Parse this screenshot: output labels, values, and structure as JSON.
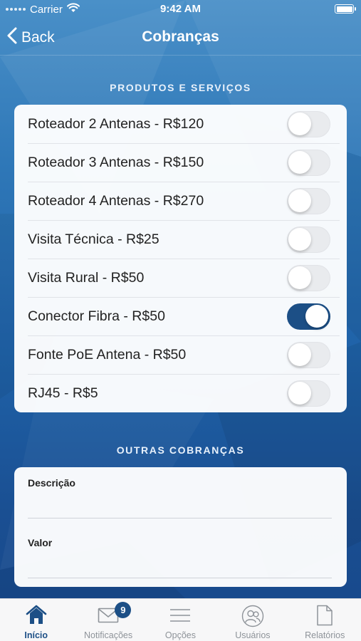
{
  "status_bar": {
    "carrier": "Carrier",
    "time": "9:42 AM"
  },
  "nav": {
    "back_label": "Back",
    "title": "Cobranças"
  },
  "products": {
    "section_title": "PRODUTOS E SERVIÇOS",
    "items": [
      {
        "label": "Roteador 2 Antenas - R$120",
        "on": false
      },
      {
        "label": "Roteador 3 Antenas - R$150",
        "on": false
      },
      {
        "label": "Roteador 4 Antenas - R$270",
        "on": false
      },
      {
        "label": "Visita Técnica - R$25",
        "on": false
      },
      {
        "label": "Visita Rural - R$50",
        "on": false
      },
      {
        "label": "Conector Fibra - R$50",
        "on": true
      },
      {
        "label": "Fonte PoE Antena - R$50",
        "on": false
      },
      {
        "label": "RJ45 - R$5",
        "on": false
      }
    ]
  },
  "other": {
    "section_title": "OUTRAS COBRANÇAS",
    "description_label": "Descrição",
    "description_value": "",
    "value_label": "Valor",
    "value_value": ""
  },
  "tabs": [
    {
      "label": "Início",
      "icon": "home-icon",
      "active": true
    },
    {
      "label": "Notificações",
      "icon": "envelope-icon",
      "badge": "9"
    },
    {
      "label": "Opções",
      "icon": "menu-lines-icon"
    },
    {
      "label": "Usuários",
      "icon": "users-icon"
    },
    {
      "label": "Relatórios",
      "icon": "document-icon"
    }
  ],
  "colors": {
    "accent": "#1c4f86",
    "switch_off": "#e9ebee",
    "tab_inactive": "#8e9399"
  }
}
